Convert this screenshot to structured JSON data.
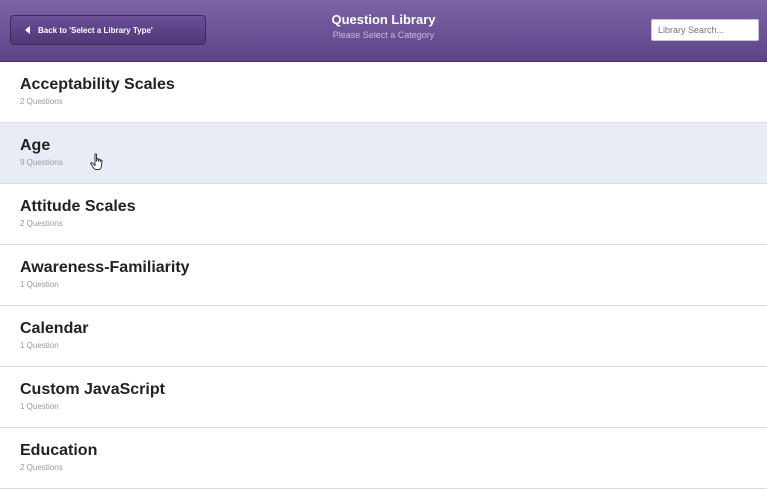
{
  "header": {
    "back_label": "Back to 'Select a Library Type'",
    "title": "Question Library",
    "subtitle": "Please Select a Category",
    "search_placeholder": "Library Search..."
  },
  "categories": [
    {
      "name": "Acceptability Scales",
      "count": "2 Questions"
    },
    {
      "name": "Age",
      "count": "9 Questions",
      "hovered": true
    },
    {
      "name": "Attitude Scales",
      "count": "2 Questions"
    },
    {
      "name": "Awareness-Familiarity",
      "count": "1 Question"
    },
    {
      "name": "Calendar",
      "count": "1 Question"
    },
    {
      "name": "Custom JavaScript",
      "count": "1 Question"
    },
    {
      "name": "Education",
      "count": "2 Questions"
    }
  ],
  "icons": {
    "back": "left-arrow-icon",
    "cursor": "hand-pointer-icon"
  },
  "colors": {
    "header": "#6b5196",
    "hover_row": "#e8edf5"
  }
}
